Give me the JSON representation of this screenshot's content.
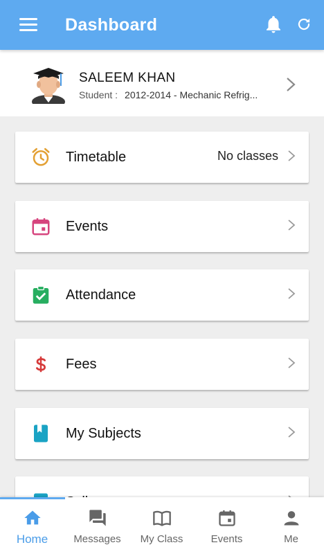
{
  "app_bar": {
    "title": "Dashboard",
    "color": "#5eaaf0",
    "menu_icon": "hamburger-menu-icon",
    "notification_icon": "bell-icon",
    "refresh_icon": "refresh-icon"
  },
  "profile": {
    "name": "SALEEM KHAN",
    "role": "Student :",
    "details": "2012-2014 - Mechanic Refrig..."
  },
  "menu": [
    {
      "label": "Timetable",
      "value": "No classes",
      "icon": "alarm-clock-icon",
      "color": "#e3a033"
    },
    {
      "label": "Events",
      "value": "",
      "icon": "calendar-icon",
      "color": "#d6457e"
    },
    {
      "label": "Attendance",
      "value": "",
      "icon": "clipboard-check-icon",
      "color": "#27ae60"
    },
    {
      "label": "Fees",
      "value": "",
      "icon": "dollar-icon",
      "color": "#d63a3a"
    },
    {
      "label": "My Subjects",
      "value": "",
      "icon": "book-icon",
      "color": "#1aa3c4"
    },
    {
      "label": "Sylla",
      "value": "",
      "icon": "syllabus-icon",
      "color": "#1aa3c4"
    }
  ],
  "bottom_nav": [
    {
      "label": "Home",
      "icon": "home-icon",
      "active": true
    },
    {
      "label": "Messages",
      "icon": "messages-icon",
      "active": false
    },
    {
      "label": "My Class",
      "icon": "open-book-icon",
      "active": false
    },
    {
      "label": "Events",
      "icon": "calendar-icon",
      "active": false
    },
    {
      "label": "Me",
      "icon": "person-icon",
      "active": false
    }
  ],
  "colors": {
    "accent": "#5eaaf0",
    "active_tab": "#4a9ce8",
    "inactive": "#666666"
  }
}
